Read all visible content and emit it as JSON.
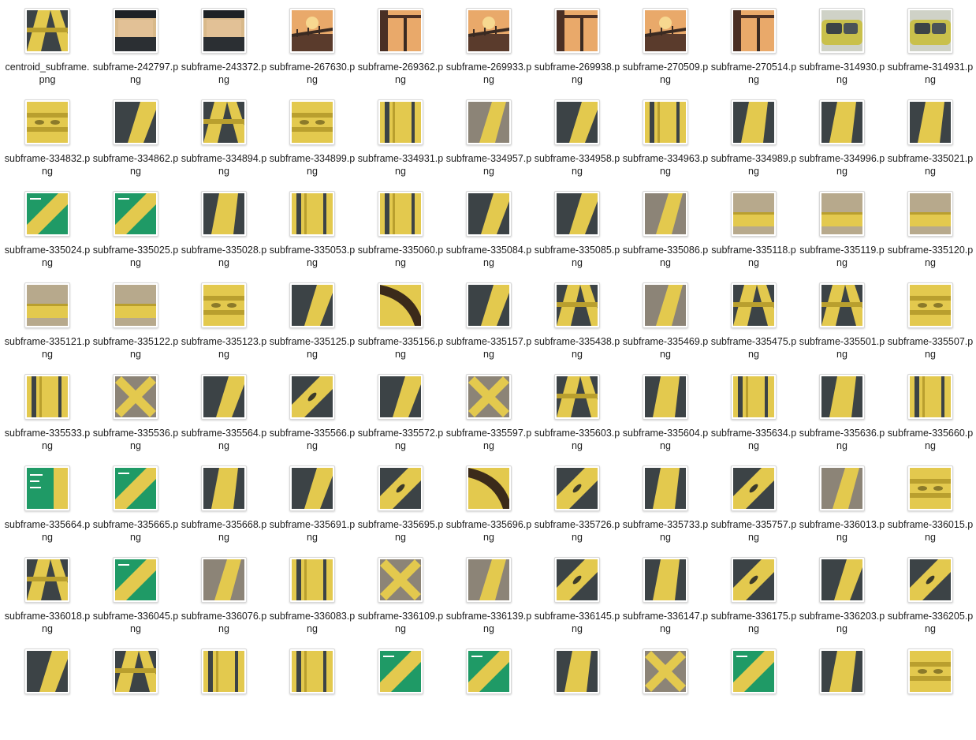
{
  "colors": {
    "girder": "#e3c94e",
    "girder_shadow": "#b99f2e",
    "dark_steel": "#3c4346",
    "sky_warm": "#e9a96a",
    "sign_green": "#1f9a66",
    "gray": "#8c8477"
  },
  "files": [
    {
      "name": "centroid_subframe.png",
      "thumb": "a-frame"
    },
    {
      "name": "subframe-242797.png",
      "thumb": "wall"
    },
    {
      "name": "subframe-243372.png",
      "thumb": "wall"
    },
    {
      "name": "subframe-267630.png",
      "thumb": "sunset-bridge"
    },
    {
      "name": "subframe-269362.png",
      "thumb": "sunset-arch"
    },
    {
      "name": "subframe-269933.png",
      "thumb": "sunset-bridge"
    },
    {
      "name": "subframe-269938.png",
      "thumb": "sunset-arch"
    },
    {
      "name": "subframe-270509.png",
      "thumb": "sunset-bridge"
    },
    {
      "name": "subframe-270514.png",
      "thumb": "sunset-arch"
    },
    {
      "name": "subframe-314930.png",
      "thumb": "car"
    },
    {
      "name": "subframe-314931.png",
      "thumb": "car"
    },
    {
      "name": "subframe-334832.png",
      "thumb": "gusset"
    },
    {
      "name": "subframe-334862.png",
      "thumb": "diag-dark"
    },
    {
      "name": "subframe-334894.png",
      "thumb": "a-frame"
    },
    {
      "name": "subframe-334899.png",
      "thumb": "gusset"
    },
    {
      "name": "subframe-334931.png",
      "thumb": "vert-bars"
    },
    {
      "name": "subframe-334957.png",
      "thumb": "diag-gray"
    },
    {
      "name": "subframe-334958.png",
      "thumb": "diag-dark"
    },
    {
      "name": "subframe-334963.png",
      "thumb": "vert-bars"
    },
    {
      "name": "subframe-334989.png",
      "thumb": "beam-center"
    },
    {
      "name": "subframe-334996.png",
      "thumb": "beam-center"
    },
    {
      "name": "subframe-335021.png",
      "thumb": "beam-center"
    },
    {
      "name": "subframe-335024.png",
      "thumb": "sign-diag"
    },
    {
      "name": "subframe-335025.png",
      "thumb": "sign-diag"
    },
    {
      "name": "subframe-335028.png",
      "thumb": "beam-center"
    },
    {
      "name": "subframe-335053.png",
      "thumb": "vert-bars"
    },
    {
      "name": "subframe-335060.png",
      "thumb": "vert-bars"
    },
    {
      "name": "subframe-335084.png",
      "thumb": "diag-dark"
    },
    {
      "name": "subframe-335085.png",
      "thumb": "diag-dark"
    },
    {
      "name": "subframe-335086.png",
      "thumb": "diag-gray"
    },
    {
      "name": "subframe-335118.png",
      "thumb": "horiz-beam"
    },
    {
      "name": "subframe-335119.png",
      "thumb": "horiz-beam"
    },
    {
      "name": "subframe-335120.png",
      "thumb": "horiz-beam"
    },
    {
      "name": "subframe-335121.png",
      "thumb": "horiz-beam"
    },
    {
      "name": "subframe-335122.png",
      "thumb": "horiz-beam"
    },
    {
      "name": "subframe-335123.png",
      "thumb": "gusset"
    },
    {
      "name": "subframe-335125.png",
      "thumb": "diag-dark"
    },
    {
      "name": "subframe-335156.png",
      "thumb": "arch"
    },
    {
      "name": "subframe-335157.png",
      "thumb": "diag-dark"
    },
    {
      "name": "subframe-335438.png",
      "thumb": "a-frame"
    },
    {
      "name": "subframe-335469.png",
      "thumb": "diag-gray"
    },
    {
      "name": "subframe-335475.png",
      "thumb": "a-frame"
    },
    {
      "name": "subframe-335501.png",
      "thumb": "a-frame"
    },
    {
      "name": "subframe-335507.png",
      "thumb": "gusset"
    },
    {
      "name": "subframe-335533.png",
      "thumb": "vert-bars"
    },
    {
      "name": "subframe-335536.png",
      "thumb": "x-brace"
    },
    {
      "name": "subframe-335564.png",
      "thumb": "diag-dark"
    },
    {
      "name": "subframe-335566.png",
      "thumb": "slot-brace"
    },
    {
      "name": "subframe-335572.png",
      "thumb": "diag-dark"
    },
    {
      "name": "subframe-335597.png",
      "thumb": "x-brace"
    },
    {
      "name": "subframe-335603.png",
      "thumb": "a-frame"
    },
    {
      "name": "subframe-335604.png",
      "thumb": "beam-center"
    },
    {
      "name": "subframe-335634.png",
      "thumb": "vert-bars"
    },
    {
      "name": "subframe-335636.png",
      "thumb": "beam-center"
    },
    {
      "name": "subframe-335660.png",
      "thumb": "vert-bars"
    },
    {
      "name": "subframe-335664.png",
      "thumb": "sign"
    },
    {
      "name": "subframe-335665.png",
      "thumb": "sign-diag"
    },
    {
      "name": "subframe-335668.png",
      "thumb": "beam-center"
    },
    {
      "name": "subframe-335691.png",
      "thumb": "diag-dark"
    },
    {
      "name": "subframe-335695.png",
      "thumb": "slot-brace"
    },
    {
      "name": "subframe-335696.png",
      "thumb": "arch"
    },
    {
      "name": "subframe-335726.png",
      "thumb": "slot-brace"
    },
    {
      "name": "subframe-335733.png",
      "thumb": "beam-center"
    },
    {
      "name": "subframe-335757.png",
      "thumb": "slot-brace"
    },
    {
      "name": "subframe-336013.png",
      "thumb": "diag-gray"
    },
    {
      "name": "subframe-336015.png",
      "thumb": "gusset"
    },
    {
      "name": "subframe-336018.png",
      "thumb": "a-frame"
    },
    {
      "name": "subframe-336045.png",
      "thumb": "sign-diag"
    },
    {
      "name": "subframe-336076.png",
      "thumb": "diag-gray"
    },
    {
      "name": "subframe-336083.png",
      "thumb": "vert-bars"
    },
    {
      "name": "subframe-336109.png",
      "thumb": "x-brace"
    },
    {
      "name": "subframe-336139.png",
      "thumb": "diag-gray"
    },
    {
      "name": "subframe-336145.png",
      "thumb": "slot-brace"
    },
    {
      "name": "subframe-336147.png",
      "thumb": "beam-center"
    },
    {
      "name": "subframe-336175.png",
      "thumb": "slot-brace"
    },
    {
      "name": "subframe-336203.png",
      "thumb": "diag-dark"
    },
    {
      "name": "subframe-336205.png",
      "thumb": "slot-brace"
    },
    {
      "name": "",
      "thumb": "diag-dark"
    },
    {
      "name": "",
      "thumb": "a-frame"
    },
    {
      "name": "",
      "thumb": "vert-bars"
    },
    {
      "name": "",
      "thumb": "vert-bars"
    },
    {
      "name": "",
      "thumb": "sign-diag"
    },
    {
      "name": "",
      "thumb": "sign-diag"
    },
    {
      "name": "",
      "thumb": "beam-center"
    },
    {
      "name": "",
      "thumb": "x-brace"
    },
    {
      "name": "",
      "thumb": "sign-diag"
    },
    {
      "name": "",
      "thumb": "beam-center"
    },
    {
      "name": "",
      "thumb": "gusset"
    }
  ]
}
